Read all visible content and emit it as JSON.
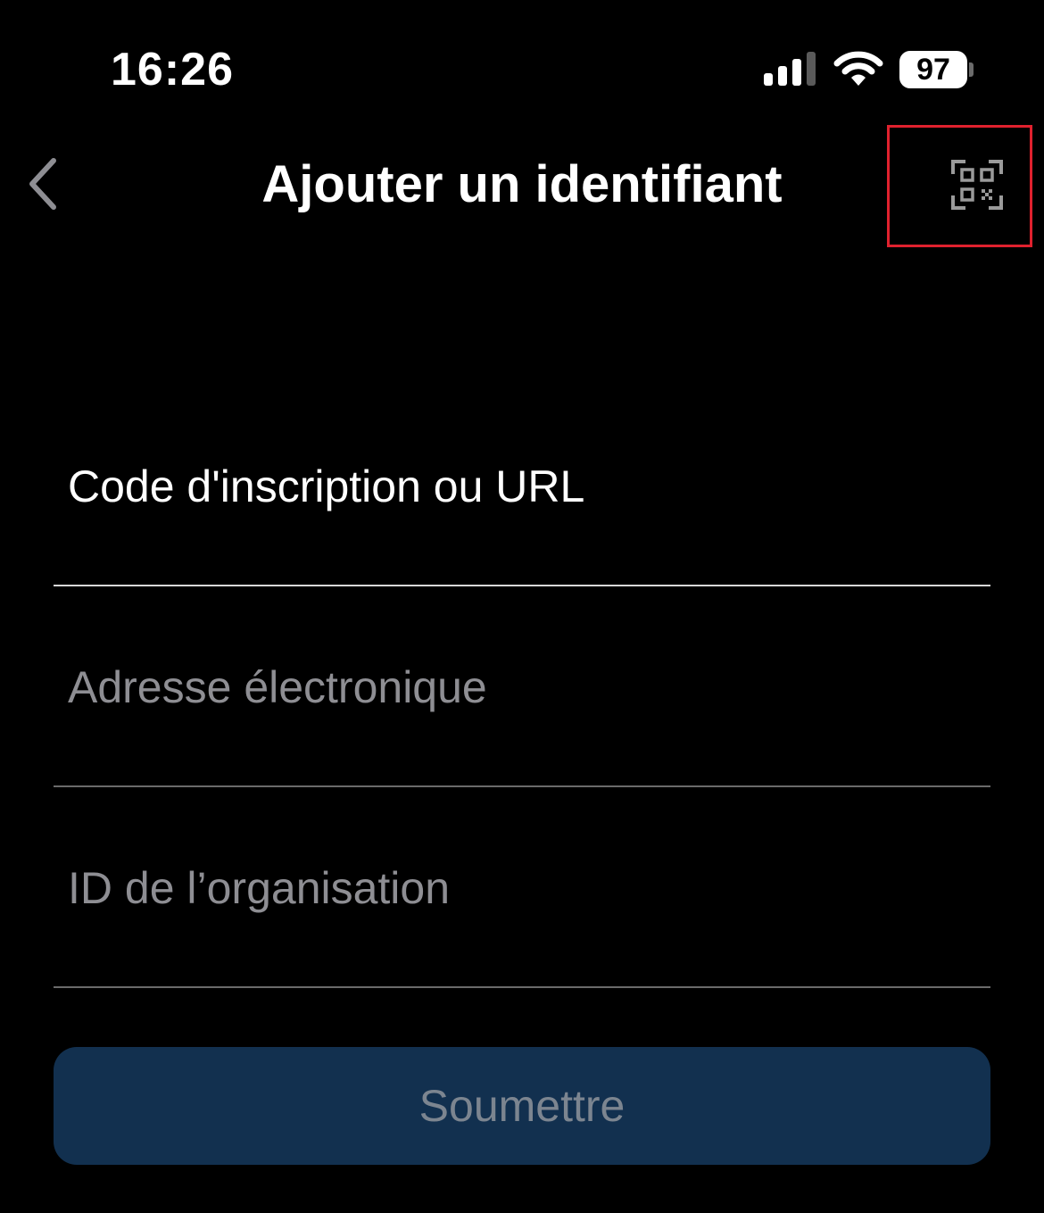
{
  "status_bar": {
    "time": "16:26",
    "battery_level": "97",
    "icons": [
      "signal-icon",
      "wifi-icon",
      "battery-icon"
    ]
  },
  "nav": {
    "title": "Ajouter un identifiant",
    "back_icon": "chevron-left-icon",
    "qr_icon": "qr-code-scan-icon"
  },
  "form": {
    "enrollment_field": {
      "placeholder": "Code d'inscription ou URL",
      "value": ""
    },
    "email_field": {
      "placeholder": "Adresse électronique",
      "value": ""
    },
    "org_id_field": {
      "placeholder": "ID de l’organisation",
      "value": ""
    },
    "submit_label": "Soumettre"
  },
  "colors": {
    "background": "#000000",
    "button_background": "#12304f",
    "button_text_disabled": "#7c8590",
    "placeholder": "#8e8e93",
    "highlight_annotation": "#e0212e"
  }
}
